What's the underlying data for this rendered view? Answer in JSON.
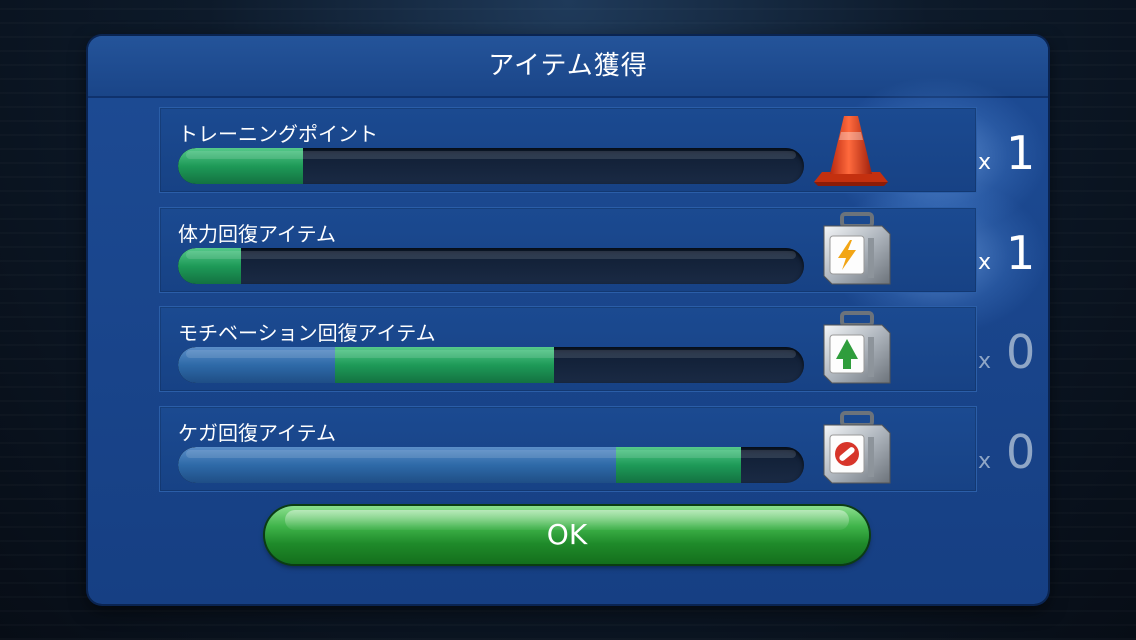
{
  "dialog": {
    "title": "アイテム獲得",
    "ok_label": "OK"
  },
  "items": [
    {
      "label": "トレーニングポイント",
      "icon": "training-cone-icon",
      "multiplier_symbol": "x",
      "count": "1",
      "gauge": {
        "previous": 0,
        "current": 0.2
      },
      "highlighted": true
    },
    {
      "label": "体力回復アイテム",
      "icon": "stamina-kit-icon",
      "multiplier_symbol": "x",
      "count": "1",
      "gauge": {
        "previous": 0,
        "current": 0.1
      },
      "highlighted": true
    },
    {
      "label": "モチベーション回復アイテム",
      "icon": "motivation-kit-icon",
      "multiplier_symbol": "x",
      "count": "0",
      "gauge": {
        "previous": 0.25,
        "current": 0.6
      },
      "highlighted": false
    },
    {
      "label": "ケガ回復アイテム",
      "icon": "injury-kit-icon",
      "multiplier_symbol": "x",
      "count": "0",
      "gauge": {
        "previous": 0.7,
        "current": 0.9
      },
      "highlighted": false
    }
  ],
  "colors": {
    "modal": "#1d4b94",
    "gauge_blue": "#2e6aa8",
    "gauge_green": "#1e9a58",
    "ok_button": "#3fb44a"
  }
}
